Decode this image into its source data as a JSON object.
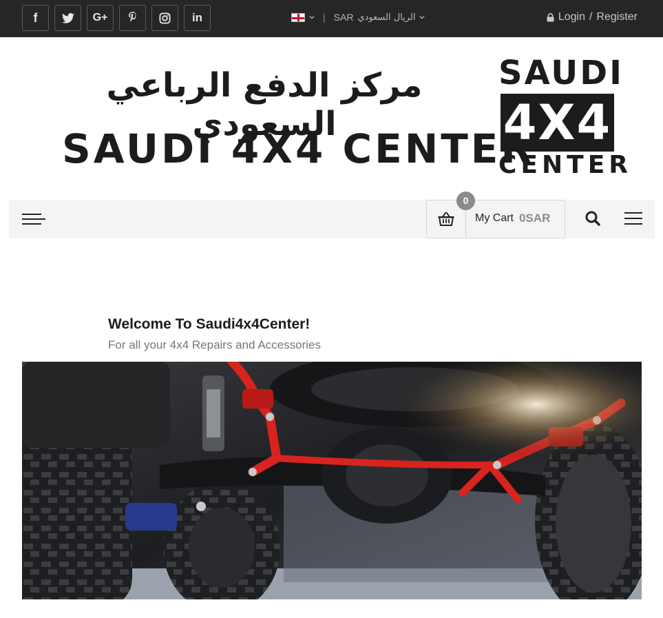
{
  "topbar": {
    "social": [
      {
        "name": "facebook",
        "glyph": "f"
      },
      {
        "name": "twitter",
        "glyph": ""
      },
      {
        "name": "google-plus",
        "glyph": "G+"
      },
      {
        "name": "pinterest",
        "glyph": ""
      },
      {
        "name": "instagram",
        "glyph": ""
      },
      {
        "name": "linkedin",
        "glyph": "in"
      }
    ],
    "currency_code": "SAR",
    "currency_name": "الريال السعودي",
    "login_label": "Login",
    "login_separator": "/",
    "register_label": "Register"
  },
  "header": {
    "arabic_name": "مركز الدفع الرباعي السعودي",
    "english_name": "SAUDI 4X4 CENTER",
    "logo_top": "SAUDI",
    "logo_middle": "4X4",
    "logo_bottom": "CENTER"
  },
  "nav": {
    "cart_count": "0",
    "cart_label": "My Cart",
    "cart_amount": "0SAR"
  },
  "welcome": {
    "title": "Welcome To Saudi4x4Center!",
    "subtitle": "For all your 4x4 Repairs and Accessories"
  },
  "colors": {
    "topbar_bg": "#262626",
    "navbar_bg": "#f4f4f4",
    "accent_red": "#d8231f"
  }
}
